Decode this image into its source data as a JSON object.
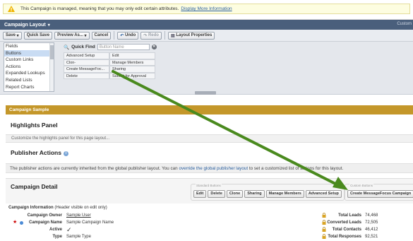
{
  "banner": {
    "text": "This Campaign is managed, meaning that you may only edit certain attributes.",
    "link": "Display More Information"
  },
  "header": {
    "title": "Campaign Layout",
    "right_text": "Custom"
  },
  "toolbar": {
    "save": "Save",
    "quick_save": "Quick Save",
    "preview_as": "Preview As...",
    "cancel": "Cancel",
    "undo": "Undo",
    "redo": "Redo",
    "layout_properties": "Layout Properties"
  },
  "palette": {
    "categories": [
      "Fields",
      "Buttons",
      "Custom Links",
      "Actions",
      "Expanded Lookups",
      "Related Lists",
      "Report Charts"
    ],
    "selected_index": 1,
    "quick_find_label": "Quick Find",
    "quick_find_placeholder": "Button Name",
    "buttons": [
      [
        "Advanced Setup",
        "Edit"
      ],
      [
        "Clon-",
        "Manage Members"
      ],
      [
        "Create MessageFoc...",
        "Sharing"
      ],
      [
        "Delete",
        "Submit for Approval"
      ]
    ]
  },
  "layout": {
    "section_band": "Campaign Sample",
    "highlights_title": "Highlights Panel",
    "highlights_hint": "Customize the highlights panel for this page layout...",
    "publisher_title": "Publisher Actions",
    "publisher_text_before": "The publisher actions are currently inherited from the global publisher layout. You can",
    "publisher_link": "override the global publisher layout",
    "publisher_text_after": "to set a customized list of actions for this layout.",
    "detail_title": "Campaign Detail",
    "standard_buttons_label": "Standard Buttons",
    "custom_buttons_label": "Custom Buttons",
    "standard_buttons": [
      "Edit",
      "Delete",
      "Clone",
      "Sharing",
      "Manage Members",
      "Advanced Setup"
    ],
    "custom_buttons": [
      "Create MessageFocus Campaign"
    ]
  },
  "fields": {
    "section_header": "Campaign Information",
    "section_hint": "(Header visible on edit only)",
    "left": [
      {
        "label": "Campaign Owner",
        "value": "Sample User",
        "underline": true
      },
      {
        "label": "Campaign Name",
        "value": "Sample Campaign Name",
        "underline": false,
        "required": true
      },
      {
        "label": "Active",
        "value": "✓",
        "underline": false
      },
      {
        "label": "Type",
        "value": "Sample Type",
        "underline": false
      }
    ],
    "right": [
      {
        "label": "Total Leads",
        "value": "74,468"
      },
      {
        "label": "Converted Leads",
        "value": "72,505"
      },
      {
        "label": "Total Contacts",
        "value": "46,412"
      },
      {
        "label": "Total Responses",
        "value": "92,521"
      }
    ]
  },
  "colors": {
    "header": "#4a5f7c",
    "band": "#c4972a",
    "arrow": "#4a8a1e",
    "link": "#2b5f9e"
  }
}
